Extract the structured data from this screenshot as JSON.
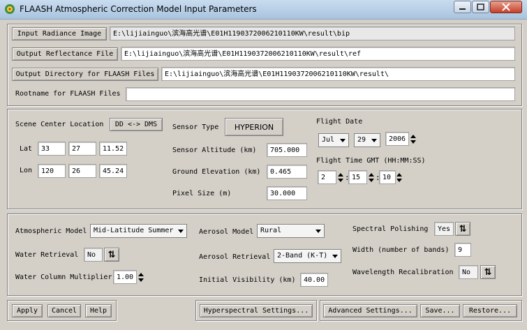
{
  "window": {
    "title": "FLAASH Atmospheric Correction Model Input Parameters"
  },
  "files": {
    "input_radiance_label": "Input Radiance Image",
    "input_radiance_path": "E:\\lijiainguo\\滨海高光谱\\E01H1190372006210110KW\\result\\bip",
    "output_reflectance_label": "Output Reflectance File",
    "output_reflectance_path": "E:\\lijiainguo\\滨海高光谱\\E01H1190372006210110KW\\result\\ref",
    "output_directory_label": "Output Directory for FLAASH Files",
    "output_directory_path": "E:\\lijiainguo\\滨海高光谱\\E01H1190372006210110KW\\result\\",
    "rootname_label": "Rootname for FLAASH Files",
    "rootname_value": ""
  },
  "scene": {
    "center_label": "Scene Center Location",
    "dd_dms_label": "DD <-> DMS",
    "lat_label": "Lat",
    "lat": [
      "33",
      "27",
      "11.52"
    ],
    "lon_label": "Lon",
    "lon": [
      "120",
      "26",
      "45.24"
    ]
  },
  "sensor": {
    "type_label": "Sensor Type",
    "type_value": "HYPERION",
    "altitude_label": "Sensor Altitude (km)",
    "altitude_value": "705.000",
    "ground_label": "Ground Elevation (km)",
    "ground_value": "0.465",
    "pixel_label": "Pixel Size (m)",
    "pixel_value": "30.000"
  },
  "flight": {
    "date_label": "Flight Date",
    "month": "Jul",
    "day": "29",
    "year": "2006",
    "time_label": "Flight Time GMT (HH:MM:SS)",
    "hh": "2",
    "mm": "15",
    "ss": "10",
    "sep": ":"
  },
  "atmosphere": {
    "model_label": "Atmospheric Model",
    "model_value": "Mid-Latitude Summer",
    "water_retrieval_label": "Water Retrieval",
    "water_retrieval_value": "No",
    "water_column_label": "Water Column Multiplier",
    "water_column_value": "1.00"
  },
  "aerosol": {
    "model_label": "Aerosol Model",
    "model_value": "Rural",
    "retrieval_label": "Aerosol Retrieval",
    "retrieval_value": "2-Band (K-T)",
    "visibility_label": "Initial Visibility (km)",
    "visibility_value": "40.00"
  },
  "spectral": {
    "polishing_label": "Spectral Polishing",
    "polishing_value": "Yes",
    "width_label": "Width (number of bands)",
    "width_value": "9",
    "recal_label": "Wavelength Recalibration",
    "recal_value": "No"
  },
  "buttons": {
    "apply": "Apply",
    "cancel": "Cancel",
    "help": "Help",
    "hyperspectral": "Hyperspectral Settings...",
    "advanced": "Advanced Settings...",
    "save": "Save...",
    "restore": "Restore..."
  },
  "colors": {
    "dialog_bg": "#d4d0c8",
    "titlebar": "#b9d1ea",
    "close_button": "#c4402a"
  }
}
